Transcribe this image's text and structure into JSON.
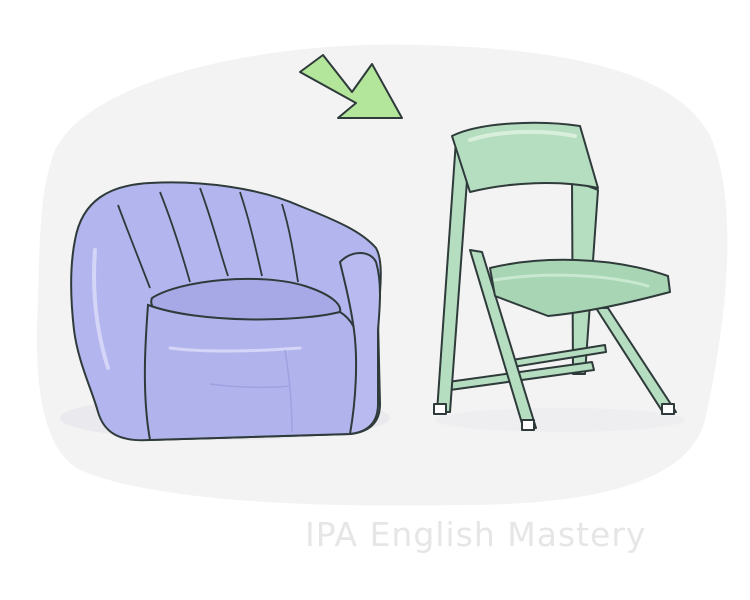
{
  "illustration": {
    "items": [
      "armchair",
      "folding-chair"
    ],
    "pointer": "arrow-down-right-icon",
    "colors": {
      "backdrop": "#f3f3f4",
      "armchair": "#b3b5ee",
      "folding_chair": "#b5ddc0",
      "arrow": "#b3e59a",
      "outline": "#2f3a3a"
    }
  },
  "watermark": {
    "text": "IPA English Mastery"
  }
}
